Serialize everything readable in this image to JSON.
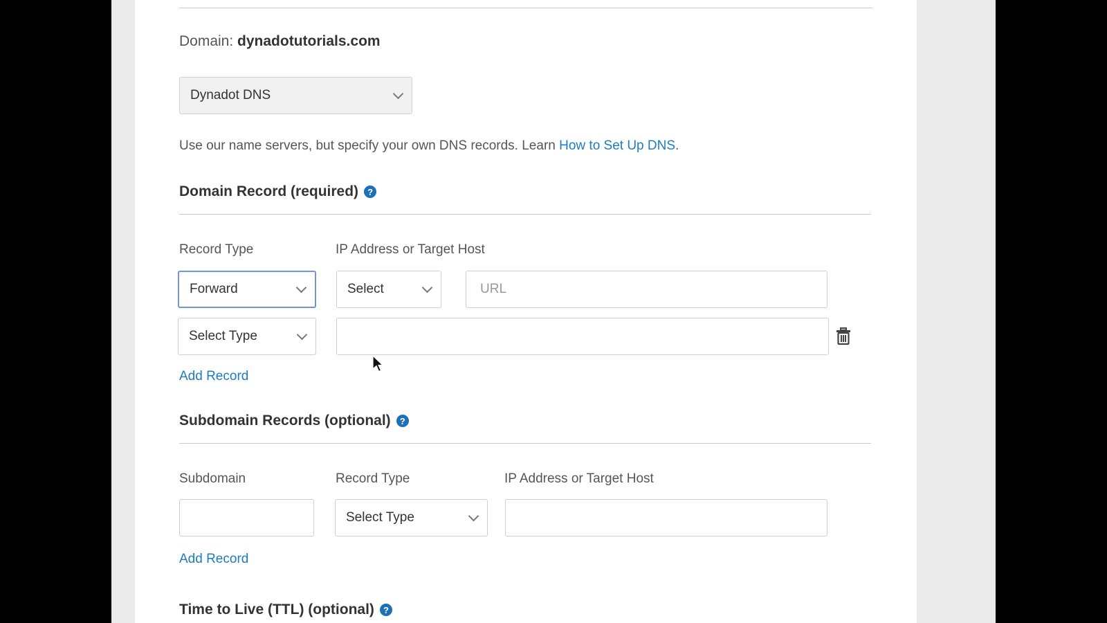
{
  "domain": {
    "label": "Domain:",
    "name": "dynadotutorials.com"
  },
  "dns_select": {
    "value": "Dynadot DNS"
  },
  "description": {
    "text": "Use our name servers, but specify your own DNS records. Learn ",
    "link": "How to Set Up DNS",
    "trailing": "."
  },
  "domain_record": {
    "title": "Domain Record (required)",
    "col_record_type": "Record Type",
    "col_target": "IP Address or Target Host",
    "row1": {
      "type": "Forward",
      "sub_select": "Select",
      "url_placeholder": "URL"
    },
    "row2": {
      "type": "Select Type",
      "value": ""
    },
    "add_record": "Add Record"
  },
  "subdomain_records": {
    "title": "Subdomain Records (optional)",
    "col_subdomain": "Subdomain",
    "col_record_type": "Record Type",
    "col_target": "IP Address or Target Host",
    "type_value": "Select Type",
    "add_record": "Add Record"
  },
  "ttl": {
    "title": "Time to Live (TTL) (optional)"
  },
  "icons": {
    "help": "question-circle-icon",
    "delete": "trash-icon",
    "dropdown": "chevron-down-icon"
  },
  "colors": {
    "link": "#1d7cc0",
    "help": "#1d6fb8",
    "focus": "#6f96d8"
  }
}
